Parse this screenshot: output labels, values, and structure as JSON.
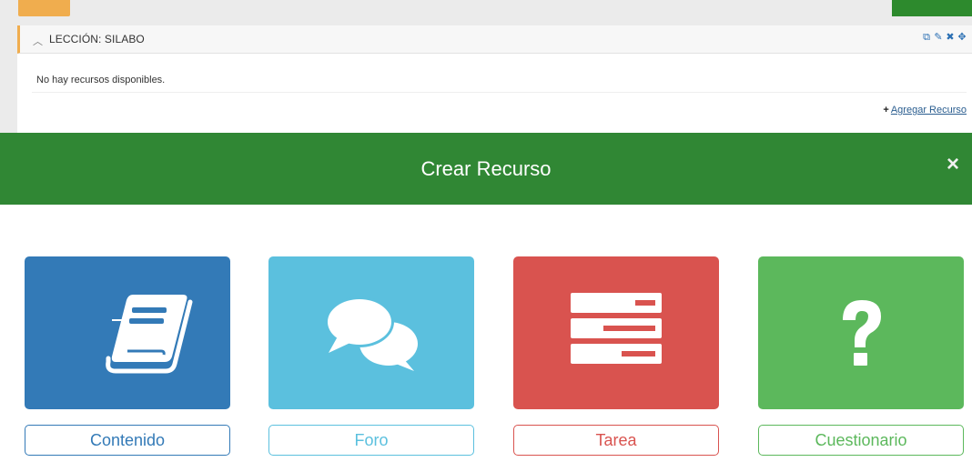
{
  "lesson": {
    "title": "LECCIÓN: SILABO",
    "empty_message": "No hay recursos disponibles.",
    "add_resource_label": "Agregar Recurso"
  },
  "modal": {
    "title": "Crear Recurso",
    "close_glyph": "×"
  },
  "resource_types": [
    {
      "label": "Contenido",
      "icon": "book-icon",
      "color": "#337ab7"
    },
    {
      "label": "Foro",
      "icon": "chat-bubbles-icon",
      "color": "#5bc0de"
    },
    {
      "label": "Tarea",
      "icon": "task-list-icon",
      "color": "#d9534f"
    },
    {
      "label": "Cuestionario",
      "icon": "question-mark-icon",
      "color": "#5cb85c"
    }
  ]
}
